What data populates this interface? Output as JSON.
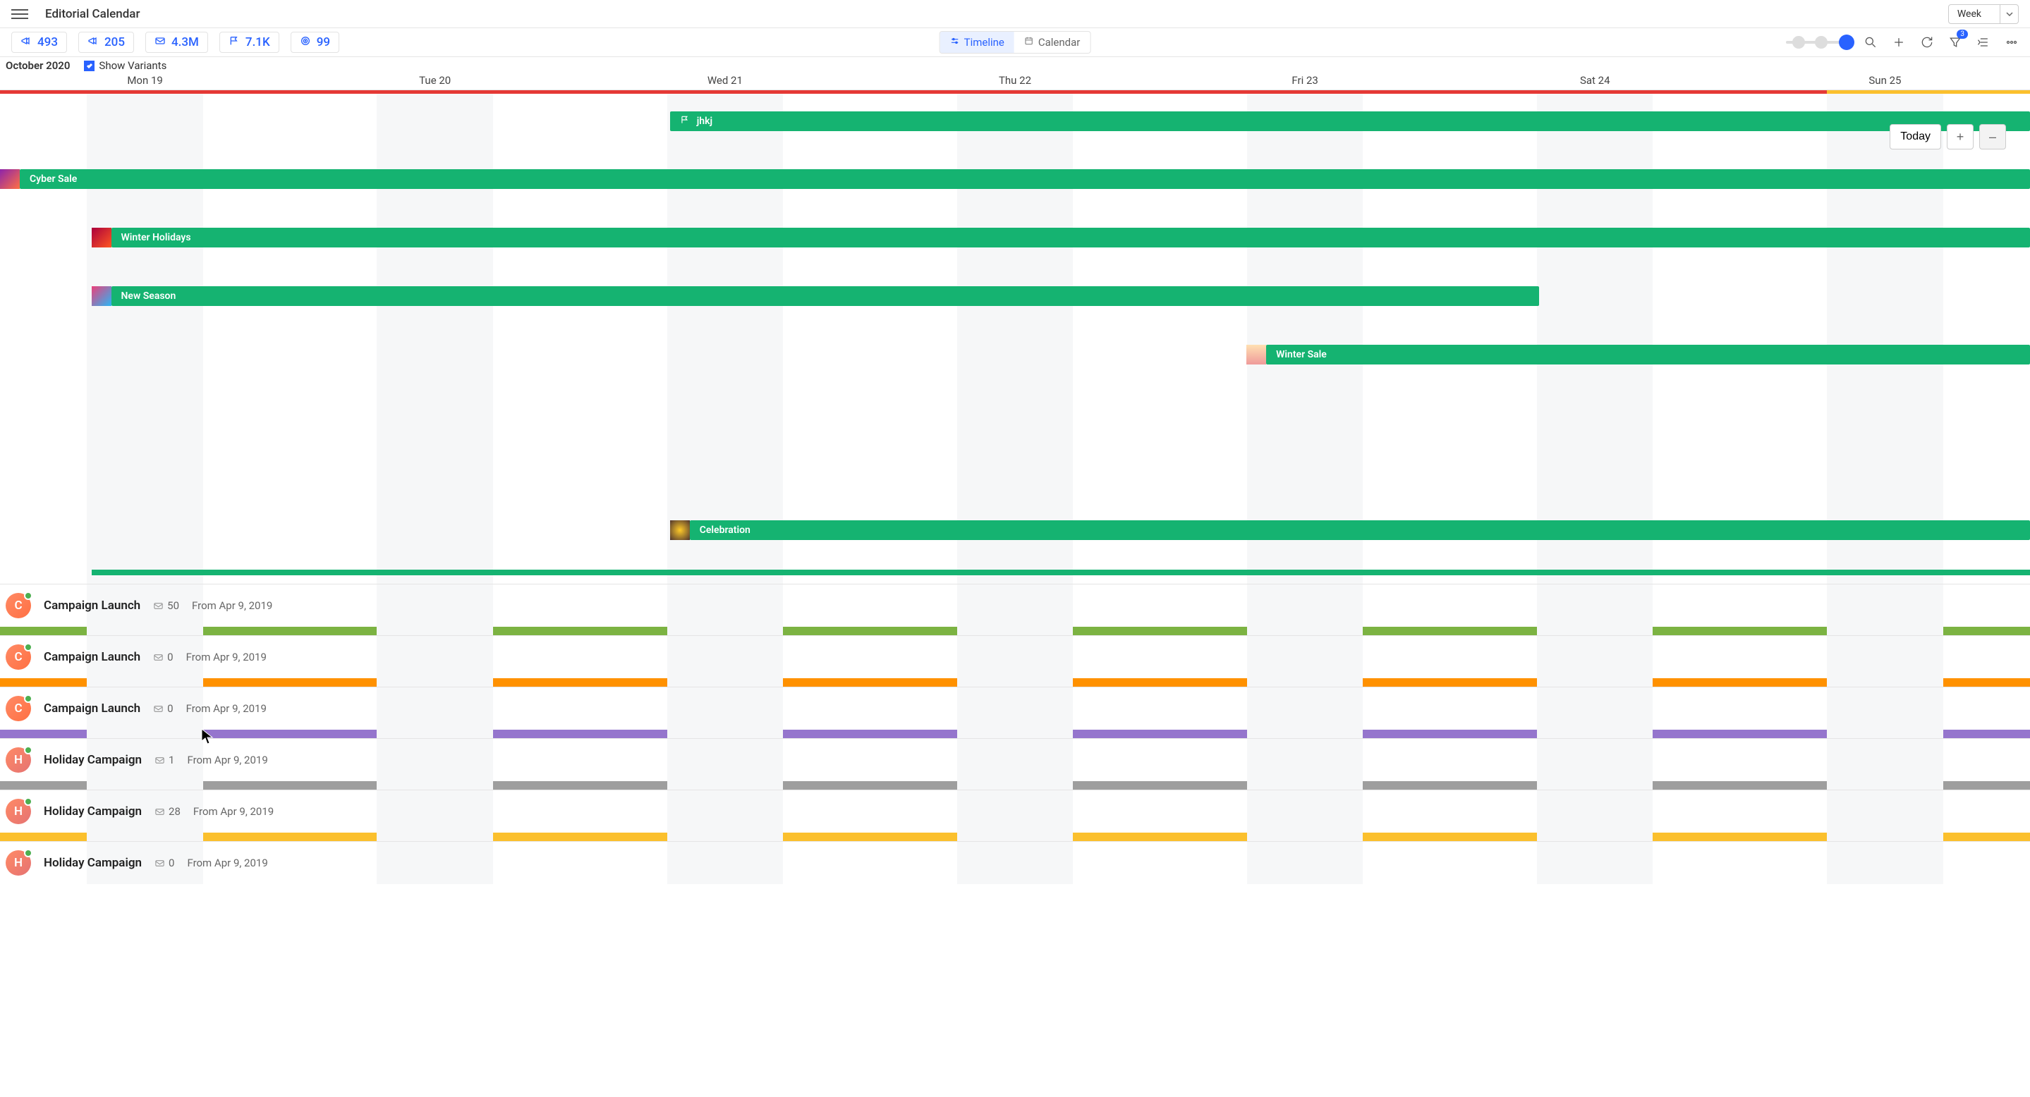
{
  "header": {
    "title": "Editorial Calendar",
    "range_selector": "Week"
  },
  "toolbar": {
    "stats": [
      {
        "icon": "megaphone",
        "value": "493"
      },
      {
        "icon": "megaphone",
        "value": "205"
      },
      {
        "icon": "envelope",
        "value": "4.3M"
      },
      {
        "icon": "flag",
        "value": "7.1K"
      },
      {
        "icon": "target",
        "value": "99"
      }
    ],
    "views": {
      "timeline": "Timeline",
      "calendar": "Calendar"
    },
    "filter_badge": "3"
  },
  "subheader": {
    "month": "October 2020",
    "show_variants_label": "Show Variants",
    "days": [
      "Mon 19",
      "Tue 20",
      "Wed 21",
      "Thu 22",
      "Fri 23",
      "Sat 24",
      "Sun 25"
    ]
  },
  "timeline": {
    "today_label": "Today",
    "plus": "+",
    "minus": "–",
    "bars": {
      "jhkj": "jhkj",
      "cyber": "Cyber Sale",
      "winterh": "Winter Holidays",
      "newseason": "New Season",
      "wintersale": "Winter Sale",
      "celebration": "Celebration"
    }
  },
  "list": [
    {
      "initial": "C",
      "title": "Campaign Launch",
      "count": "50",
      "date": "From Apr 9, 2019",
      "stripe": "stripe-green"
    },
    {
      "initial": "C",
      "title": "Campaign Launch",
      "count": "0",
      "date": "From Apr 9, 2019",
      "stripe": "stripe-orange"
    },
    {
      "initial": "C",
      "title": "Campaign Launch",
      "count": "0",
      "date": "From Apr 9, 2019",
      "stripe": "stripe-purple"
    },
    {
      "initial": "H",
      "title": "Holiday Campaign",
      "count": "1",
      "date": "From Apr 9, 2019",
      "stripe": "stripe-gray"
    },
    {
      "initial": "H",
      "title": "Holiday Campaign",
      "count": "28",
      "date": "From Apr 9, 2019",
      "stripe": "stripe-yellow"
    },
    {
      "initial": "H",
      "title": "Holiday Campaign",
      "count": "0",
      "date": "From Apr 9, 2019",
      "stripe": "stripe-purple"
    }
  ]
}
